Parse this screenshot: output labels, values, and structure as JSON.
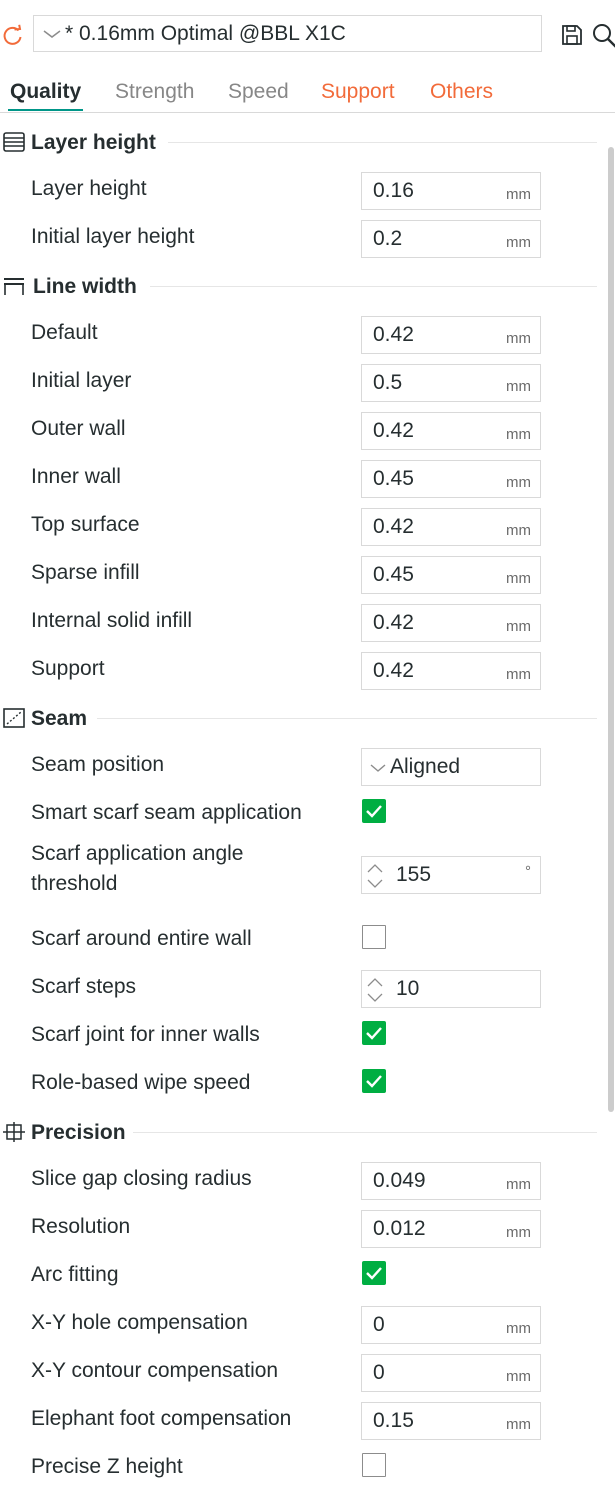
{
  "toolbar": {
    "preset_name": "* 0.16mm Optimal @BBL X1C",
    "reset_icon": "reset-arrow-icon",
    "save_icon": "save-icon",
    "search_icon": "search-icon"
  },
  "tabs": [
    {
      "label": "Quality",
      "state": "active"
    },
    {
      "label": "Strength",
      "state": "normal"
    },
    {
      "label": "Speed",
      "state": "normal"
    },
    {
      "label": "Support",
      "state": "modified"
    },
    {
      "label": "Others",
      "state": "modified"
    }
  ],
  "colors": {
    "accent_modified": "#f26b3a",
    "active_underline": "#009688",
    "checkbox_on": "#00ae42"
  },
  "groups": {
    "layer_height": {
      "title": "Layer height",
      "rows": [
        {
          "label": "Layer height",
          "value": "0.16",
          "unit": "mm"
        },
        {
          "label": "Initial layer height",
          "value": "0.2",
          "unit": "mm"
        }
      ]
    },
    "line_width": {
      "title": "Line width",
      "rows": [
        {
          "label": "Default",
          "value": "0.42",
          "unit": "mm"
        },
        {
          "label": "Initial layer",
          "value": "0.5",
          "unit": "mm"
        },
        {
          "label": "Outer wall",
          "value": "0.42",
          "unit": "mm"
        },
        {
          "label": "Inner wall",
          "value": "0.45",
          "unit": "mm"
        },
        {
          "label": "Top surface",
          "value": "0.42",
          "unit": "mm"
        },
        {
          "label": "Sparse infill",
          "value": "0.45",
          "unit": "mm"
        },
        {
          "label": "Internal solid infill",
          "value": "0.42",
          "unit": "mm"
        },
        {
          "label": "Support",
          "value": "0.42",
          "unit": "mm"
        }
      ]
    },
    "seam": {
      "title": "Seam",
      "seam_position": {
        "label": "Seam position",
        "value": "Aligned"
      },
      "smart_scarf": {
        "label": "Smart scarf seam application",
        "checked": true
      },
      "scarf_angle": {
        "label": "Scarf application angle threshold",
        "value": "155",
        "unit": "°"
      },
      "scarf_entire": {
        "label": "Scarf around entire wall",
        "checked": false
      },
      "scarf_steps": {
        "label": "Scarf steps",
        "value": "10"
      },
      "scarf_inner": {
        "label": "Scarf joint for inner walls",
        "checked": true
      },
      "role_wipe": {
        "label": "Role-based wipe speed",
        "checked": true
      }
    },
    "precision": {
      "title": "Precision",
      "slice_gap": {
        "label": "Slice gap closing radius",
        "value": "0.049",
        "unit": "mm"
      },
      "resolution": {
        "label": "Resolution",
        "value": "0.012",
        "unit": "mm"
      },
      "arc_fitting": {
        "label": "Arc fitting",
        "checked": true
      },
      "xy_hole": {
        "label": "X-Y hole compensation",
        "value": "0",
        "unit": "mm"
      },
      "xy_contour": {
        "label": "X-Y contour compensation",
        "value": "0",
        "unit": "mm"
      },
      "elephant": {
        "label": "Elephant foot compensation",
        "value": "0.15",
        "unit": "mm"
      },
      "precise_z": {
        "label": "Precise Z height",
        "checked": false
      }
    }
  }
}
